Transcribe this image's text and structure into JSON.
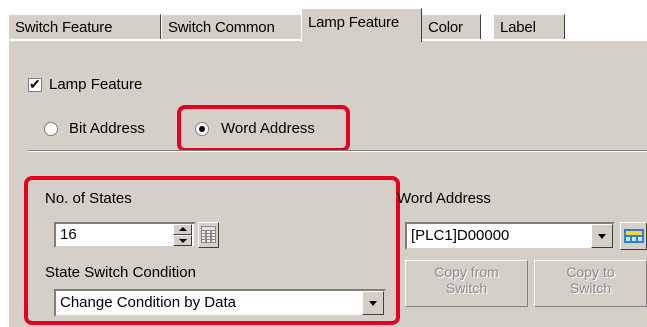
{
  "tabs": [
    {
      "label": "Switch Feature"
    },
    {
      "label": "Switch Common"
    },
    {
      "label": "Lamp Feature"
    },
    {
      "label": "Color"
    },
    {
      "label": "Label"
    }
  ],
  "lamp_feature": {
    "label": "Lamp Feature",
    "checked": true
  },
  "address_type": {
    "bit_label": "Bit Address",
    "word_label": "Word Address",
    "selected": "Word Address"
  },
  "states": {
    "label": "No. of States",
    "value": "16"
  },
  "switch_condition": {
    "label": "State Switch Condition",
    "value": "Change Condition by Data"
  },
  "word_address": {
    "label": "Word Address",
    "value": "[PLC1]D00000"
  },
  "copy_from_button": {
    "line1": "Copy from",
    "line2": "Switch"
  },
  "copy_to_button": {
    "line1": "Copy to",
    "line2": "Switch"
  },
  "colors": {
    "highlight": "#e6001e",
    "panel": "#d4d0c8"
  },
  "icons": [
    "keypad-icon",
    "calculator-icon",
    "spinner-up-icon",
    "spinner-down-icon",
    "dropdown-arrow-icon",
    "checkmark-icon"
  ]
}
